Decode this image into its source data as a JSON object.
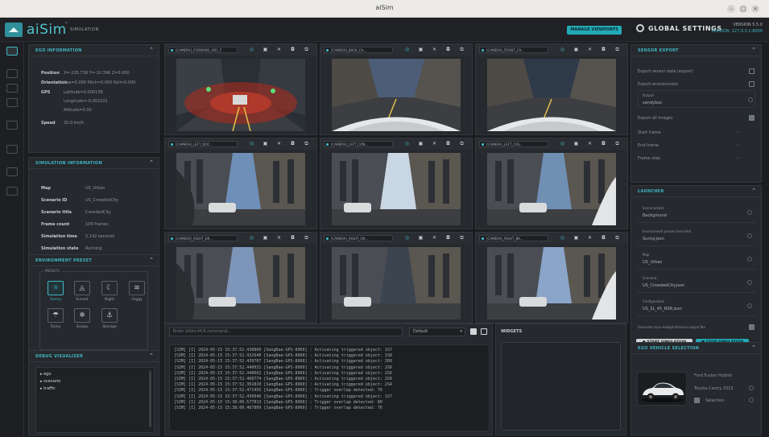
{
  "os": {
    "title": "aiSim",
    "controls": [
      "–",
      "□",
      "×"
    ]
  },
  "header": {
    "logo": "aiSim",
    "logo_sup": "™",
    "logo_sub": "SIMULATION",
    "manage_viewports": "MANAGE VIEWPORTS",
    "global_settings": "GLOBAL SETTINGS",
    "version_label": "VERSION 5.5.0",
    "version_sub": "VERSION: 127.0.0.1:8000"
  },
  "ego": {
    "title": "EGO INFORMATION",
    "rows": [
      {
        "k": "Position",
        "v": "X=-235.738 Y=-10.396 Z=0.000"
      },
      {
        "k": "Orientation",
        "v": "Yaw=0.000 Pitch=0.000 Roll=0.000"
      },
      {
        "k": "GPS",
        "v": "Latitude=0.000138"
      }
    ],
    "gps2": "Longitude=-0.002101",
    "gps3": "Altitude=0.00",
    "speed_k": "Speed",
    "speed_v": "20.0 km/h"
  },
  "siminfo": {
    "title": "SIMULATION INFORMATION",
    "rows": [
      {
        "k": "Map",
        "v": "US_Urban"
      },
      {
        "k": "Scenario ID",
        "v": "US_CrowdedCity"
      },
      {
        "k": "Scenario title",
        "v": "CrowdedCity"
      },
      {
        "k": "Frame count",
        "v": "109  frames"
      },
      {
        "k": "Simulation time",
        "v": "5.142  seconds"
      },
      {
        "k": "Simulation state",
        "v": "Running"
      }
    ]
  },
  "env": {
    "title": "ENVIRONMENT PRESET",
    "sub": "PRESETS",
    "presets": [
      {
        "label": "Sunny",
        "icon": "☼"
      },
      {
        "label": "Sunset",
        "icon": "◬"
      },
      {
        "label": "Night",
        "icon": "☾"
      },
      {
        "label": "Foggy",
        "icon": "≋"
      },
      {
        "label": "Rainy",
        "icon": "☂"
      },
      {
        "label": "Snowy",
        "icon": "❄"
      },
      {
        "label": "Storage",
        "icon": "⚓"
      }
    ]
  },
  "debug": {
    "title": "DEBUG VISUALIZER",
    "items": [
      "▸ ego",
      "▸ scenario",
      "▸ traffic"
    ]
  },
  "cameras": [
    "[CAMERA]_FORWARD_ADC_F",
    "[CAMERA]_BACK_CA...",
    "[CAMERA]_FRONT_CA...",
    "[CAMERA]_LEFT_DOC...",
    "[CAMERA]_LEFT_CON...",
    "[CAMERA]_LEFT_CRS...",
    "[CAMERA]_RIGHT_DR...",
    "[CAMERA]_RIGHT_CN...",
    "[CAMERA]_RIGHT_BK..."
  ],
  "console": {
    "placeholder": "Enter aiSim-PCR command...",
    "level": "Default",
    "lines": [
      "[SIM] [I] 2024-05-15 15:37:52.430860 [SangBae-GPS-8960] : Activating triggered object: 1S7",
      "[SIM] [I] 2024-05-15 15:37:52.432640 [SangBae-GPS-8960] : Activating triggered object: 1S8",
      "[SIM] [I] 2024-05-15 15:37:52.439707 [SangBae-GPS-8960] : Activating triggered object: 209",
      "[SIM] [I] 2024-05-15 15:37:52.440031 [SangBae-GPS-8960] : Activating triggered object: 2S6",
      "[SIM] [I] 2024-05-15 15:37:52.440602 [SangBae-GPS-8960] : Activating triggered object: 2S6",
      "[SIM] [I] 2024-05-15 15:37:52.460774 [SangBae-GPS-8960] : Activating triggered object: 2S9",
      "[SIM] [I] 2024-05-15 15:37:52.361810 [SangBae-GPS-8960] : Activating triggered object: 2S4",
      "[SIM] [I] 2024-05-15 15:37:52.471455 [SangBae-GPS-8960] : Trigger overlap detected: 76",
      "[SIM] [I] 2024-05-15 15:37:52.450046 [SangBae-GPS-8960] : Activating triggered object: 1S7",
      "[SIM] [I] 2024-05-15 15:38:00.577813 [SangBae-GPS-8960] : Trigger overlap detected: 80",
      "[SIM] [I] 2024-05-15 15:38:00.467809 [SangBae-GPS-8960] : Trigger overlap detected: 76"
    ]
  },
  "widgets": {
    "title": "WIDGETS"
  },
  "sensor": {
    "title": "SENSOR EXPORT",
    "rows": [
      "Export sensor data (export)",
      "Export environment",
      "Output",
      "Export all images",
      "Start frame",
      "End frame",
      "Frame step"
    ],
    "output_val": "sandybox"
  },
  "launcher": {
    "title": "LAUNCHER",
    "fields": [
      {
        "k": "Scene preset",
        "v": "Background"
      },
      {
        "k": "Environment preset (override)",
        "v": "Sunny.json"
      },
      {
        "k": "Map",
        "v": "US_Urban"
      },
      {
        "k": "Scenario",
        "v": "US_CrowdedCity.json"
      },
      {
        "k": "Configuration",
        "v": "US_SL_45_NSR.json"
      }
    ],
    "nodelist": "Generate sync-ready/inference output file",
    "start": "START SIMULATION",
    "stop": "STOP SIMULATION"
  },
  "ego_sel": {
    "title": "EGO VEHICLE SELECTION",
    "name": "Ford Fusion Hybrid",
    "option": "Toyota Camry 2015",
    "sub": "Selection"
  }
}
